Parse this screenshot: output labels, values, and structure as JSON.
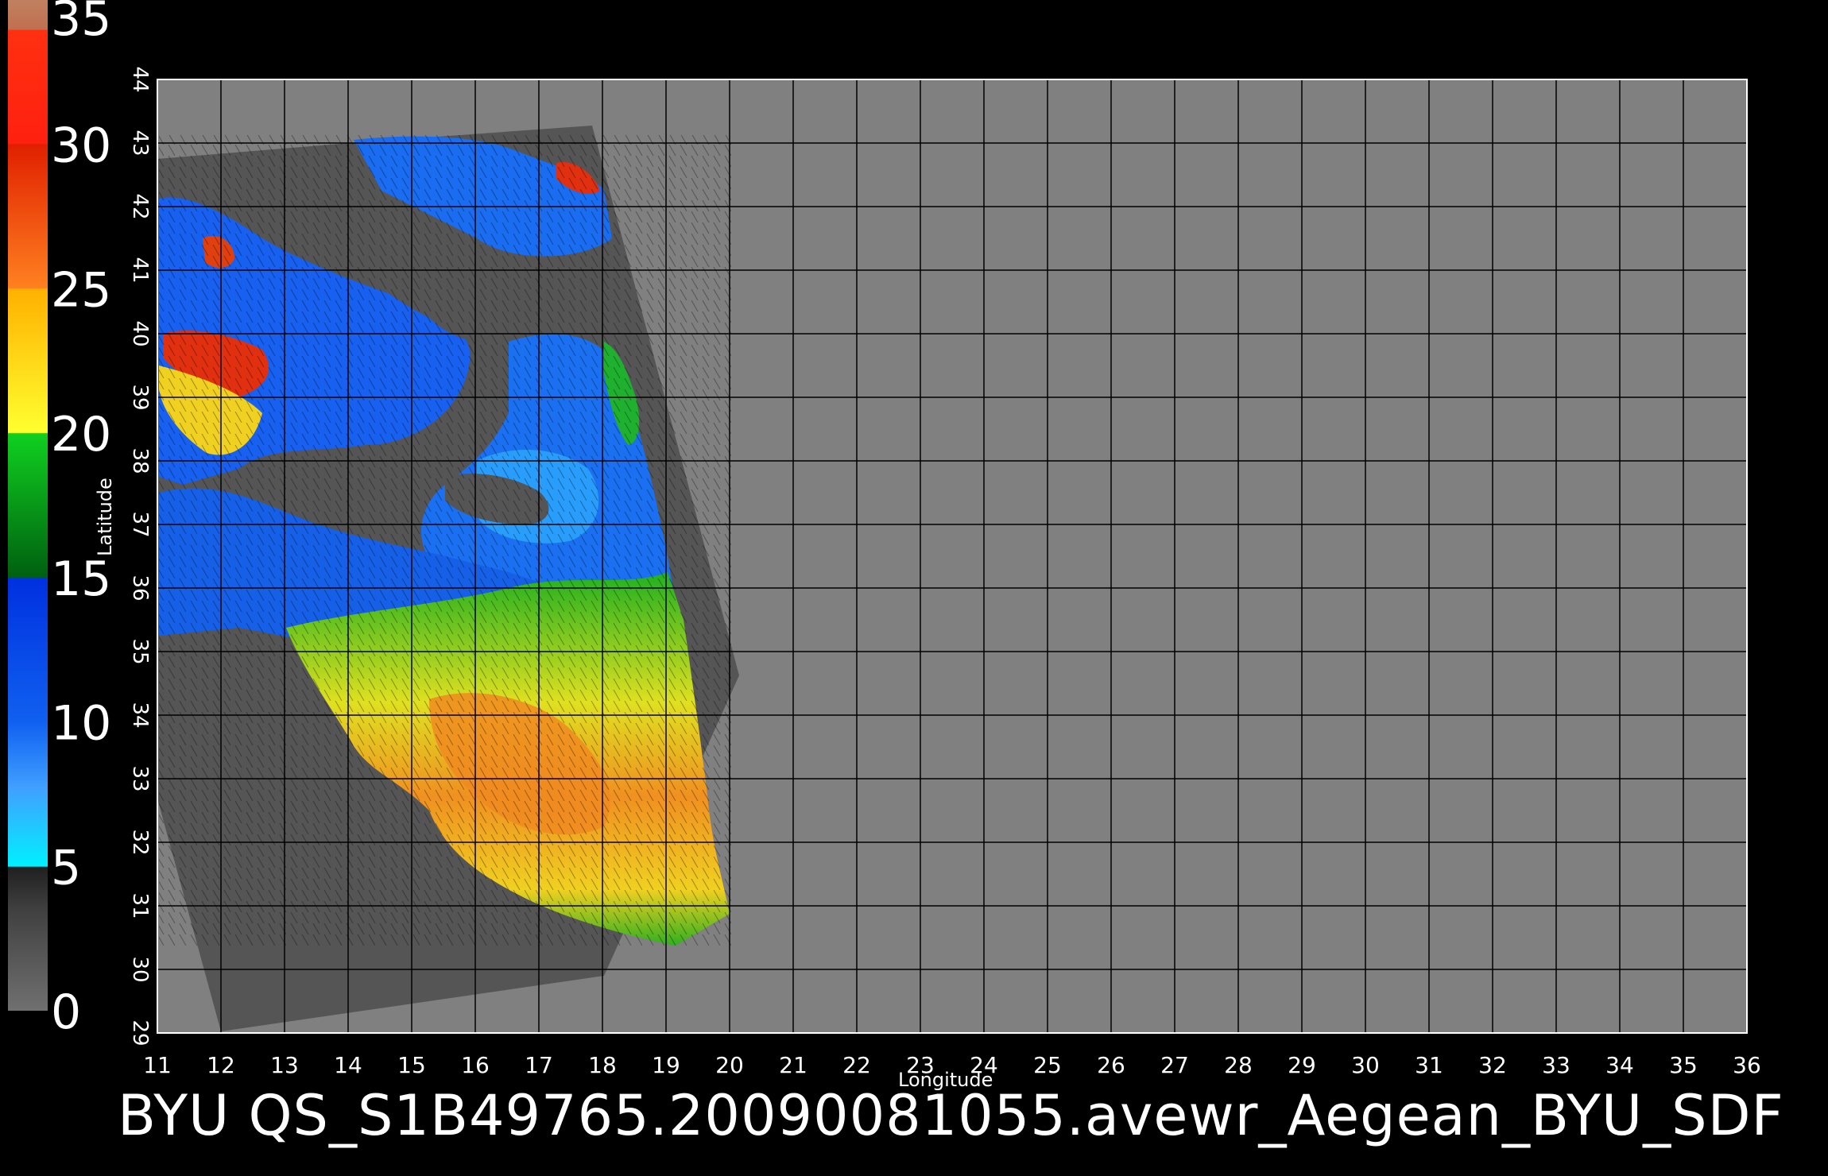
{
  "title": "BYU  QS_S1B49765.20090081055.avewr_Aegean_BYU_SDF",
  "x_axis": {
    "label": "Longitude",
    "min": 11,
    "max": 36,
    "ticks": [
      11,
      12,
      13,
      14,
      15,
      16,
      17,
      18,
      19,
      20,
      21,
      22,
      23,
      24,
      25,
      26,
      27,
      28,
      29,
      30,
      31,
      32,
      33,
      34,
      35,
      36
    ]
  },
  "y_axis": {
    "label": "Latitude",
    "min": 29,
    "max": 44,
    "ticks": [
      29,
      30,
      31,
      32,
      33,
      34,
      35,
      36,
      37,
      38,
      39,
      40,
      41,
      42,
      43,
      44
    ]
  },
  "colorbar": {
    "ticks": [
      0,
      5,
      10,
      15,
      20,
      25,
      30,
      35
    ],
    "bands": [
      {
        "from": 0,
        "to": 5,
        "color": "#4a4a4a"
      },
      {
        "from": 5,
        "to": 10,
        "color": "#1a90ff"
      },
      {
        "from": 10,
        "to": 15,
        "color": "#1040e0"
      },
      {
        "from": 15,
        "to": 20,
        "color": "#10a020"
      },
      {
        "from": 20,
        "to": 25,
        "color": "#ffd010"
      },
      {
        "from": 25,
        "to": 30,
        "color": "#ff6010"
      },
      {
        "from": 30,
        "to": 35,
        "color": "#ff2010"
      }
    ]
  },
  "colors": {
    "background": "#000000",
    "plot": "#808080",
    "swath_land": "#555555",
    "grid": "#000000"
  }
}
